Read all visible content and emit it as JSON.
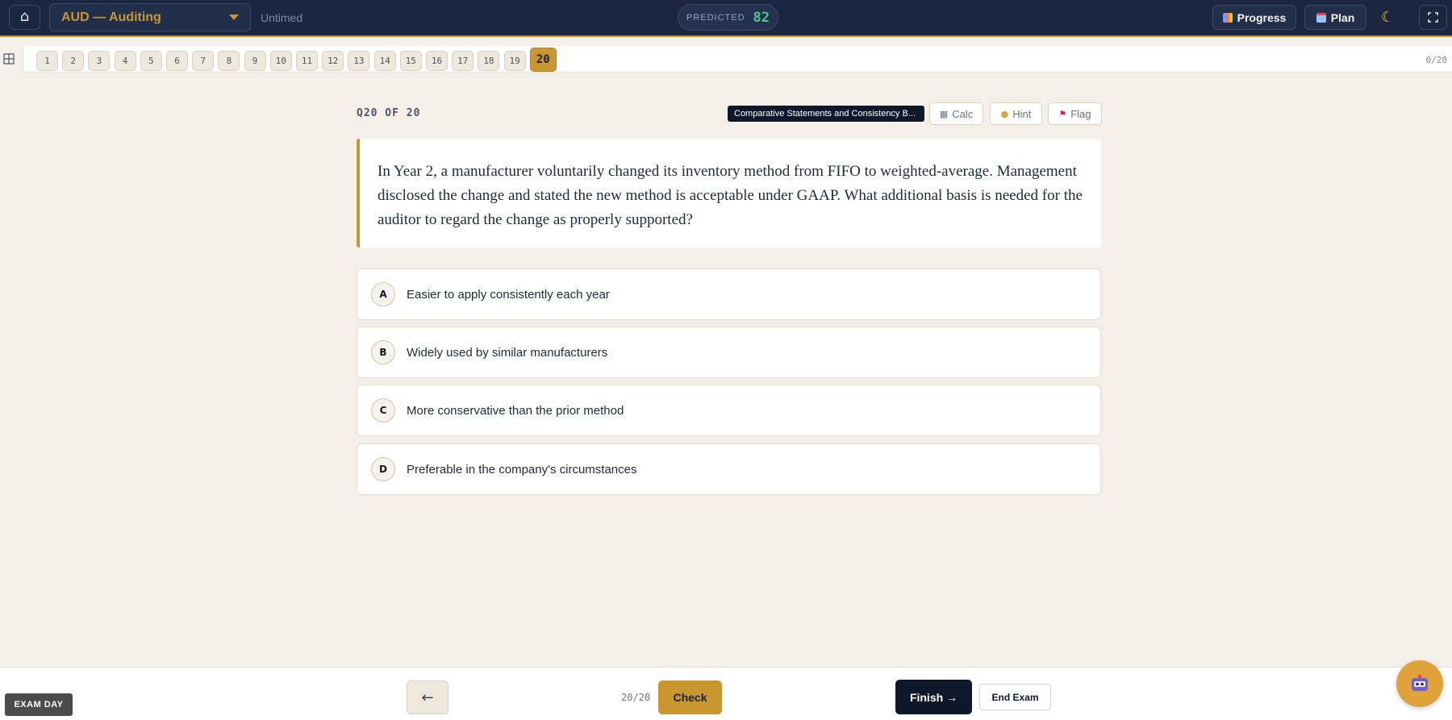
{
  "header": {
    "exam_title": "AUD — Auditing",
    "timer_mode": "Untimed",
    "predicted_label": "PREDICTED",
    "predicted_score": "82",
    "progress_label": "Progress",
    "plan_label": "Plan",
    "icons": {
      "home": "home-icon",
      "dropdown": "chevron-down-icon",
      "progress": "chart-icon",
      "plan": "calendar-icon",
      "theme": "moon-icon",
      "fullscreen": "fullscreen-icon"
    }
  },
  "navigator": {
    "questions": [
      "1",
      "2",
      "3",
      "4",
      "5",
      "6",
      "7",
      "8",
      "9",
      "10",
      "11",
      "12",
      "13",
      "14",
      "15",
      "16",
      "17",
      "18",
      "19",
      "20"
    ],
    "active": "20",
    "answered_count": "0/20"
  },
  "question": {
    "meta": "Q20 OF 20",
    "topic": "Comparative Statements and Consistency B...",
    "calc_label": "Calc",
    "hint_label": "Hint",
    "flag_label": "Flag",
    "text": "In Year 2, a manufacturer voluntarily changed its inventory method from FIFO to weighted-average. Management disclosed the change and stated the new method is acceptable under GAAP. What additional basis is needed for the auditor to regard the change as properly supported?",
    "choices": [
      {
        "letter": "A",
        "text": "Easier to apply consistently each year"
      },
      {
        "letter": "B",
        "text": "Widely used by similar manufacturers"
      },
      {
        "letter": "C",
        "text": "More conservative than the prior method"
      },
      {
        "letter": "D",
        "text": "Preferable in the company's circumstances"
      }
    ]
  },
  "footer": {
    "exam_day_label": "EXAM DAY",
    "prev_label": "←",
    "position": "20/20",
    "check_label": "Check",
    "finish_label": "Finish →",
    "end_label": "End Exam"
  },
  "colors": {
    "header_bg": "#1b2740",
    "accent_gold": "#c9962f",
    "page_bg": "#f4f0e9",
    "predicted_green": "#4fc38d",
    "finish_bg": "#0f172a"
  }
}
